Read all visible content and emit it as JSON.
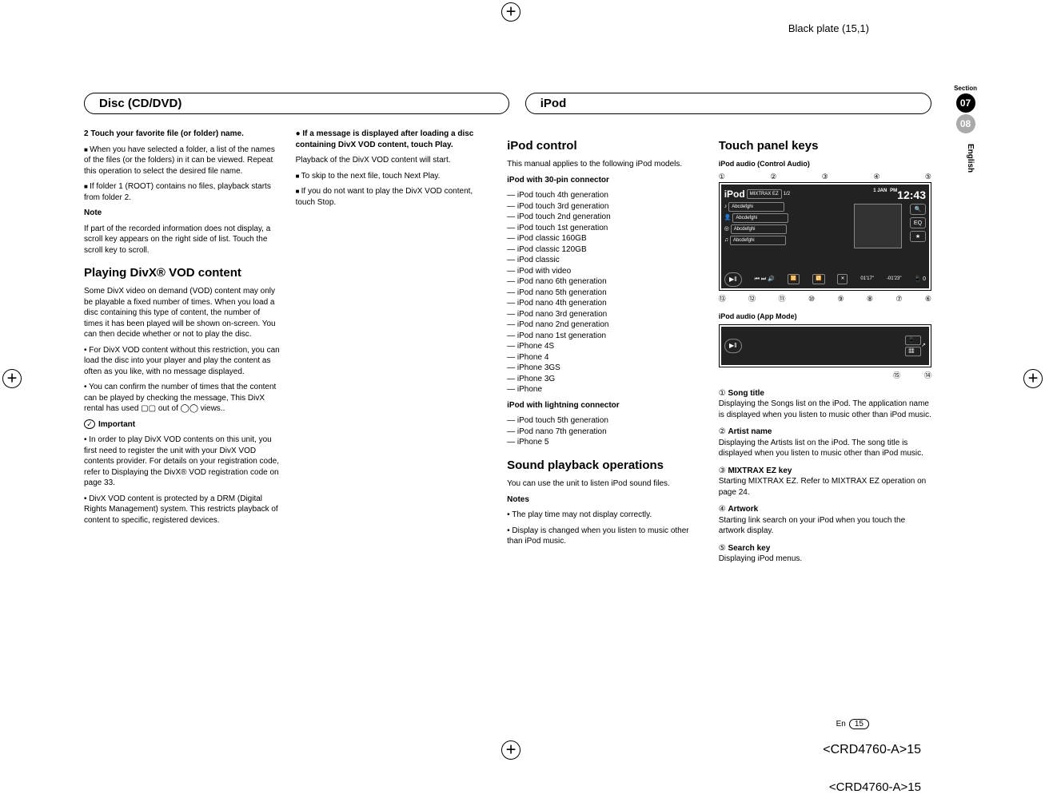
{
  "black_plate": "Black plate (15,1)",
  "section": {
    "label": "Section",
    "num1": "07",
    "num2": "08",
    "lang": "English"
  },
  "headers": {
    "left": "Disc (CD/DVD)",
    "right": "iPod"
  },
  "col1": {
    "step2_title": "2   Touch your favorite file (or folder) name.",
    "step2_b1": "When you have selected a folder, a list of the names of the files (or the folders) in it can be viewed. Repeat this operation to select the desired file name.",
    "step2_b2": "If folder 1 (ROOT) contains no files, playback starts from folder 2.",
    "note_label": "Note",
    "note_text": "If part of the recorded information does not display, a scroll key appears on the right side of list. Touch the scroll key to scroll.",
    "h2": "Playing DivX® VOD content",
    "p1": "Some DivX video on demand (VOD) content may only be playable a fixed number of times. When you load a disc containing this type of content, the number of times it has been played will be shown on-screen. You can then decide whether or not to play the disc.",
    "b1": "For DivX VOD content without this restriction, you can load the disc into your player and play the content as often as you like, with no message displayed.",
    "b2": "You can confirm the number of times that the content can be played by checking the message, This DivX rental has used ▢▢ out of ◯◯ views..",
    "important_label": "Important",
    "imp1": "In order to play DivX VOD contents on this unit, you first need to register the unit with your DivX VOD contents provider. For details on your registration code, refer to Displaying the DivX® VOD registration code on page 33.",
    "imp2": "DivX VOD content is protected by a DRM (Digital Rights Management) system. This restricts playback of content to specific, registered devices."
  },
  "col2": {
    "lead": "●  If a message is displayed after loading a disc containing DivX VOD content, touch Play.",
    "p1": "Playback of the DivX VOD content will start.",
    "b1": "To skip to the next file, touch Next Play.",
    "b2": "If you do not want to play the DivX VOD content, touch Stop."
  },
  "col3": {
    "h2a": "iPod control",
    "p1": "This manual applies to the following iPod models.",
    "sub1": "iPod with 30-pin connector",
    "list1": [
      "iPod touch 4th generation",
      "iPod touch 3rd generation",
      "iPod touch 2nd generation",
      "iPod touch 1st generation",
      "iPod classic 160GB",
      "iPod classic 120GB",
      "iPod classic",
      "iPod with video",
      "iPod nano 6th generation",
      "iPod nano 5th generation",
      "iPod nano 4th generation",
      "iPod nano 3rd generation",
      "iPod nano 2nd generation",
      "iPod nano 1st generation",
      "iPhone 4S",
      "iPhone 4",
      "iPhone 3GS",
      "iPhone 3G",
      "iPhone"
    ],
    "sub2": "iPod with lightning connector",
    "list2": [
      "iPod touch 5th generation",
      "iPod nano 7th generation",
      "iPhone 5"
    ],
    "h2b": "Sound playback operations",
    "p2": "You can use the unit to listen iPod sound files.",
    "notes_label": "Notes",
    "n1": "The play time may not display correctly.",
    "n2": "Display is changed when you listen to music other than iPod music."
  },
  "col4": {
    "h2": "Touch panel keys",
    "label1": "iPod audio (Control Audio)",
    "label2": "iPod audio (App Mode)",
    "screen": {
      "mixtrax": "MIXTRAX EZ",
      "time": "12:43",
      "date": "1  JAN",
      "ampm": "PM",
      "song": "Abcdefghi",
      "artist": "Abcdefghi",
      "album": "Abcdefghi",
      "genre": "Abcdefghi",
      "track": "1/2",
      "elapsed": "01'17\"",
      "remain": "-01'23\"",
      "eq": "EQ",
      "sb_count": "0"
    },
    "callouts_top": [
      "①",
      "②",
      "③",
      "④",
      "⑤"
    ],
    "callouts_bottom": [
      "⑬",
      "⑫",
      "⑪",
      "⑩",
      "⑨",
      "⑧",
      "⑦",
      "⑥"
    ],
    "callouts_app": [
      "⑮",
      "⑭"
    ],
    "items": [
      {
        "n": "①",
        "t": "Song title",
        "d": "Displaying the Songs list on the iPod. The application name is displayed when you listen to music other than iPod music."
      },
      {
        "n": "②",
        "t": "Artist name",
        "d": "Displaying the Artists list on the iPod. The song title is displayed when you listen to music other than iPod music."
      },
      {
        "n": "③",
        "t": "MIXTRAX EZ key",
        "d": "Starting MIXTRAX EZ. Refer to MIXTRAX EZ operation on page 24."
      },
      {
        "n": "④",
        "t": "Artwork",
        "d": "Starting link search on your iPod when you touch the artwork display."
      },
      {
        "n": "⑤",
        "t": "Search key",
        "d": "Displaying iPod menus."
      }
    ]
  },
  "footer": {
    "en": "En",
    "page": "15",
    "doc": "<CRD4760-A>15"
  }
}
